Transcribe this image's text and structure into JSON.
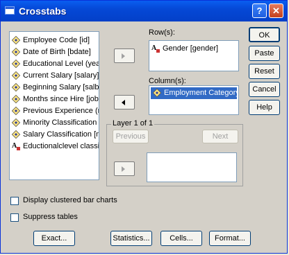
{
  "window": {
    "title": "Crosstabs",
    "help_glyph": "?",
    "close_glyph": "✕"
  },
  "variables": [
    {
      "label": "Employee Code [id]",
      "icon": "scale"
    },
    {
      "label": "Date of Birth [bdate]",
      "icon": "scale"
    },
    {
      "label": "Educational Level (yea",
      "icon": "scale"
    },
    {
      "label": "Current Salary [salary]",
      "icon": "scale"
    },
    {
      "label": "Beginning Salary [salbe",
      "icon": "scale"
    },
    {
      "label": "Months since Hire [jobt",
      "icon": "scale"
    },
    {
      "label": "Previous Experience (m",
      "icon": "scale"
    },
    {
      "label": "Minority Classification [",
      "icon": "scale"
    },
    {
      "label": "Salary Classification [ne",
      "icon": "scale"
    },
    {
      "label": "Eductionalclevel classi",
      "icon": "nominal"
    }
  ],
  "rows": {
    "label": "Row(s):",
    "items": [
      "Gender [gender]"
    ]
  },
  "columns": {
    "label": "Column(s):",
    "items": [
      "Employment Category ["
    ]
  },
  "layer": {
    "label": "Layer 1 of 1",
    "previous": "Previous",
    "next": "Next"
  },
  "buttons": {
    "ok": "OK",
    "paste": "Paste",
    "reset": "Reset",
    "cancel": "Cancel",
    "help": "Help"
  },
  "options": {
    "clustered": "Display clustered bar charts",
    "suppress": "Suppress tables"
  },
  "bottom_buttons": {
    "exact": "Exact...",
    "statistics": "Statistics...",
    "cells": "Cells...",
    "format": "Format..."
  },
  "icon_glyphs": {
    "nominal": "A"
  }
}
